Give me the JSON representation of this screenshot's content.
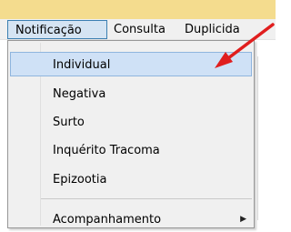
{
  "menubar": {
    "items": [
      {
        "label": "Notificação"
      },
      {
        "label": "Consulta"
      },
      {
        "label": "Duplicida"
      }
    ]
  },
  "dropdown": {
    "items": [
      {
        "label": "Individual"
      },
      {
        "label": "Negativa"
      },
      {
        "label": "Surto"
      },
      {
        "label": "Inquérito Tracoma"
      },
      {
        "label": "Epizootia"
      },
      {
        "label": "Acompanhamento",
        "submenu_icon": "triangle-right-icon"
      }
    ]
  },
  "colors": {
    "titlebar": "#f4dc8e",
    "highlight": "#cfe1f6",
    "arrow": "#e01e1e"
  }
}
